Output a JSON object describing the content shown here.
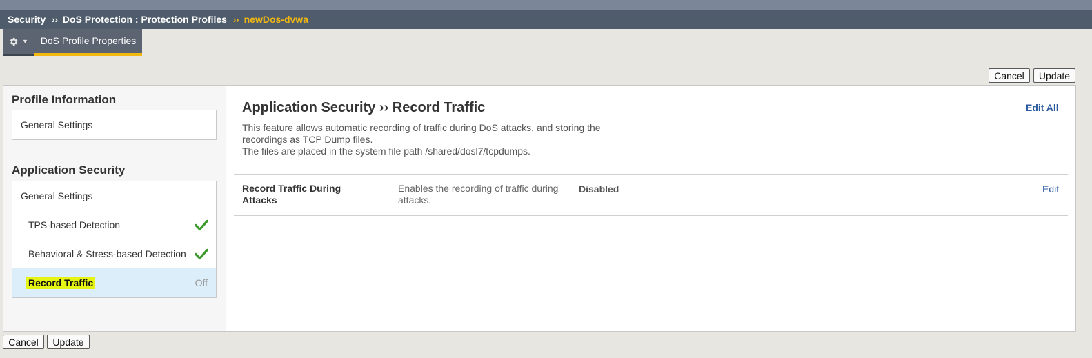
{
  "breadcrumb": {
    "items": [
      "Security",
      "DoS Protection : Protection Profiles"
    ],
    "separator": "››",
    "current": "newDos-dvwa"
  },
  "tabs": {
    "menu_icon": "gear-icon",
    "active": "DoS Profile Properties"
  },
  "actions": {
    "cancel": "Cancel",
    "update": "Update"
  },
  "sidebar": {
    "profile_info": {
      "title": "Profile Information",
      "items": [
        {
          "label": "General Settings"
        }
      ]
    },
    "app_security": {
      "title": "Application Security",
      "items": [
        {
          "label": "General Settings"
        },
        {
          "label": "TPS-based Detection",
          "status_icon": "check-icon"
        },
        {
          "label": "Behavioral & Stress-based Detection",
          "status_icon": "check-icon"
        },
        {
          "label": "Record Traffic",
          "status": "Off",
          "selected": true
        }
      ]
    }
  },
  "content": {
    "title": "Application Security ›› Record Traffic",
    "edit_all": "Edit All",
    "description": [
      "This feature allows automatic recording of traffic during DoS attacks, and storing the",
      "recordings as TCP Dump files.",
      "The files are placed in the system file path /shared/dosl7/tcpdumps."
    ],
    "rows": [
      {
        "label": [
          "Record Traffic During",
          "Attacks"
        ],
        "description": [
          "Enables the recording of traffic during",
          "attacks."
        ],
        "value": "Disabled",
        "edit": "Edit"
      }
    ]
  },
  "colors": {
    "breadcrumb_bg": "#4f5c6b",
    "accent": "#f2b811",
    "link": "#2c5aa0",
    "check": "#3a9a2a",
    "highlight": "#e5f413",
    "selected_bg": "#ddeefb"
  }
}
